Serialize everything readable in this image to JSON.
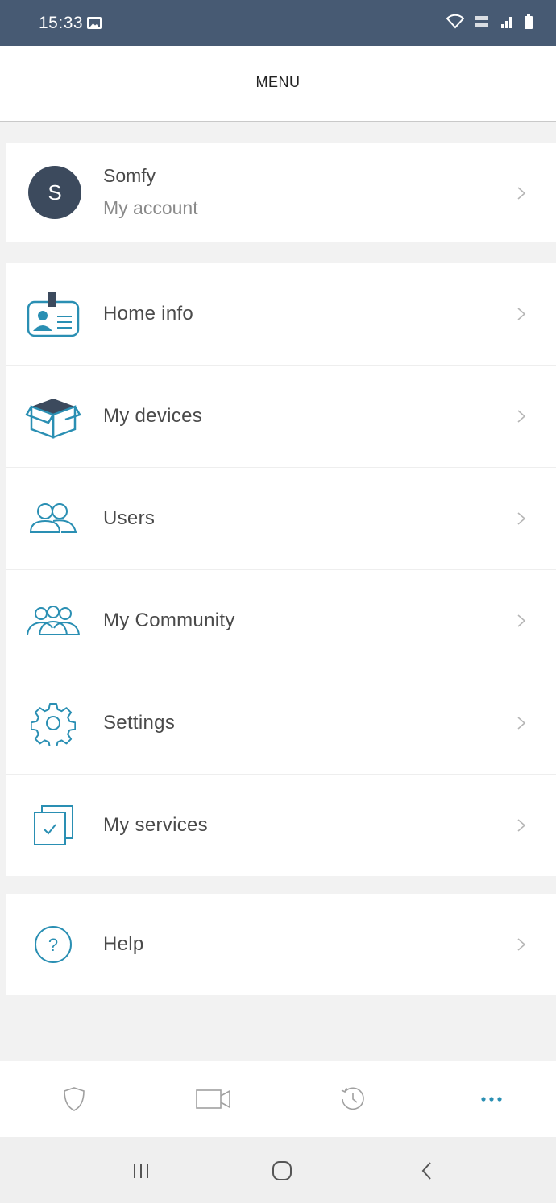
{
  "status_bar": {
    "time": "15:33"
  },
  "header": {
    "title": "MENU"
  },
  "account": {
    "initial": "S",
    "name": "Somfy",
    "subtitle": "My account"
  },
  "menu_items": [
    {
      "label": "Home info",
      "icon": "home-info-card-icon"
    },
    {
      "label": "My devices",
      "icon": "box-icon"
    },
    {
      "label": "Users",
      "icon": "users-icon"
    },
    {
      "label": "My Community",
      "icon": "community-icon"
    },
    {
      "label": "Settings",
      "icon": "gear-icon"
    },
    {
      "label": "My services",
      "icon": "services-check-icon"
    }
  ],
  "help": {
    "label": "Help",
    "icon": "question-icon"
  },
  "tab_bar": [
    {
      "icon": "shield-icon",
      "active": false
    },
    {
      "icon": "video-camera-icon",
      "active": false
    },
    {
      "icon": "history-clock-icon",
      "active": false
    },
    {
      "icon": "more-dots-icon",
      "active": true
    }
  ],
  "system_nav": [
    "recent-apps-icon",
    "home-icon",
    "back-icon"
  ],
  "colors": {
    "status_bar": "#475a73",
    "accent": "#2a8fb3",
    "avatar": "#3c4a5d",
    "icon_gray": "#a0a0a0"
  }
}
